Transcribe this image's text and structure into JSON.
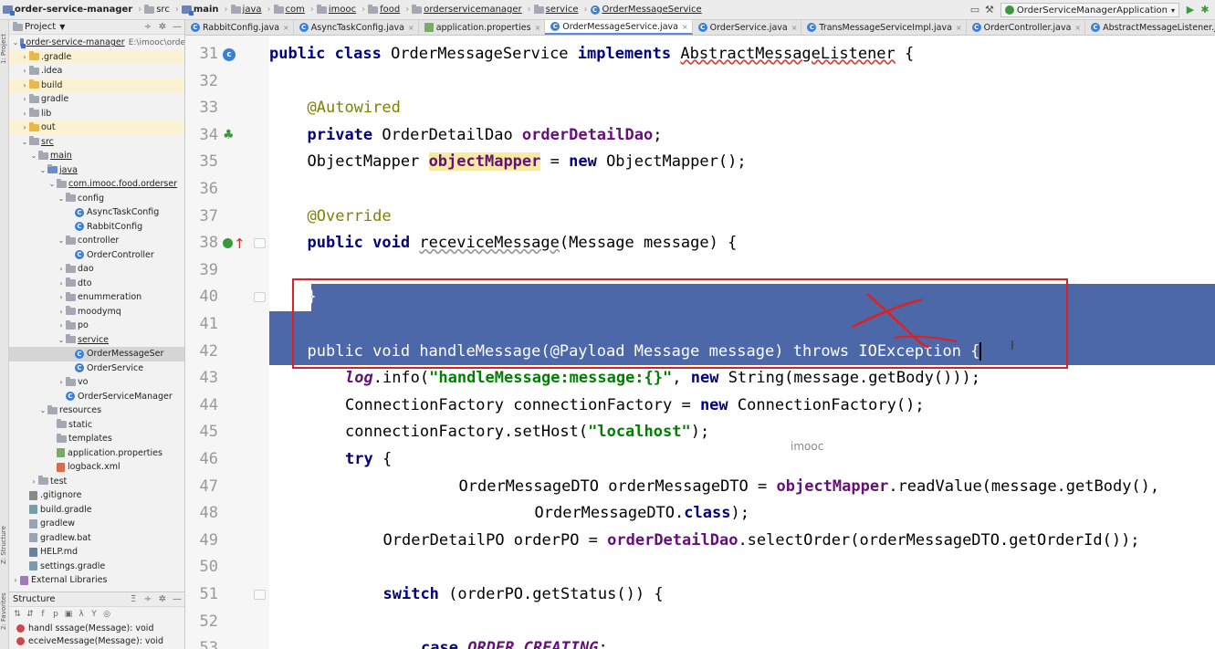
{
  "navbar": {
    "breadcrumbs": [
      {
        "label": "order-service-manager",
        "icon": "module-icon",
        "bold": true
      },
      {
        "label": "src",
        "icon": "folder-icon"
      },
      {
        "label": "main",
        "icon": "module-icon",
        "bold": true
      },
      {
        "label": "java",
        "icon": "folder-icon",
        "underline": true
      },
      {
        "label": "com",
        "icon": "folder-icon",
        "underline": true
      },
      {
        "label": "imooc",
        "icon": "folder-icon",
        "underline": true
      },
      {
        "label": "food",
        "icon": "folder-icon",
        "underline": true
      },
      {
        "label": "orderservicemanager",
        "icon": "folder-icon",
        "underline": true
      },
      {
        "label": "service",
        "icon": "folder-icon",
        "underline": true
      },
      {
        "label": "OrderMessageService",
        "icon": "class-icon",
        "underline": true
      }
    ],
    "run_config": "OrderServiceManagerApplication"
  },
  "sidebar_tabs": [
    "1: Project",
    "Z: Structure",
    "2: Favorites"
  ],
  "project": {
    "title": "Project",
    "tree": [
      {
        "label": "order-service-manager",
        "extra": "E:\\imooc\\orde",
        "level": 0,
        "arrow": "down",
        "icon": "module",
        "ul": true
      },
      {
        "label": ".gradle",
        "level": 1,
        "arrow": "right",
        "icon": "folder-yellow",
        "hl": true
      },
      {
        "label": ".idea",
        "level": 1,
        "arrow": "right",
        "icon": "folder"
      },
      {
        "label": "build",
        "level": 1,
        "arrow": "right",
        "icon": "folder-yellow",
        "hl": true
      },
      {
        "label": "gradle",
        "level": 1,
        "arrow": "right",
        "icon": "folder"
      },
      {
        "label": "lib",
        "level": 1,
        "arrow": "right",
        "icon": "folder"
      },
      {
        "label": "out",
        "level": 1,
        "arrow": "right",
        "icon": "folder-yellow",
        "hl": true
      },
      {
        "label": "src",
        "level": 1,
        "arrow": "down",
        "icon": "folder",
        "ul": true
      },
      {
        "label": "main",
        "level": 2,
        "arrow": "down",
        "icon": "folder",
        "ul": true
      },
      {
        "label": "java",
        "level": 3,
        "arrow": "down",
        "icon": "folder-blue",
        "ul": true
      },
      {
        "label": "com.imooc.food.orderser",
        "level": 4,
        "arrow": "down",
        "icon": "folder",
        "ul": true
      },
      {
        "label": "config",
        "level": 5,
        "arrow": "down",
        "icon": "folder"
      },
      {
        "label": "AsyncTaskConfig",
        "level": 6,
        "arrow": "",
        "icon": "class"
      },
      {
        "label": "RabbitConfig",
        "level": 6,
        "arrow": "",
        "icon": "class"
      },
      {
        "label": "controller",
        "level": 5,
        "arrow": "down",
        "icon": "folder"
      },
      {
        "label": "OrderController",
        "level": 6,
        "arrow": "",
        "icon": "class"
      },
      {
        "label": "dao",
        "level": 5,
        "arrow": "right",
        "icon": "folder"
      },
      {
        "label": "dto",
        "level": 5,
        "arrow": "right",
        "icon": "folder"
      },
      {
        "label": "enummeration",
        "level": 5,
        "arrow": "right",
        "icon": "folder"
      },
      {
        "label": "moodymq",
        "level": 5,
        "arrow": "right",
        "icon": "folder"
      },
      {
        "label": "po",
        "level": 5,
        "arrow": "right",
        "icon": "folder"
      },
      {
        "label": "service",
        "level": 5,
        "arrow": "down",
        "icon": "folder",
        "ul": true
      },
      {
        "label": "OrderMessageSer",
        "level": 6,
        "arrow": "",
        "icon": "class",
        "sel": true
      },
      {
        "label": "OrderService",
        "level": 6,
        "arrow": "",
        "icon": "class"
      },
      {
        "label": "vo",
        "level": 5,
        "arrow": "right",
        "icon": "folder"
      },
      {
        "label": "OrderServiceManager",
        "level": 5,
        "arrow": "",
        "icon": "class"
      },
      {
        "label": "resources",
        "level": 3,
        "arrow": "down",
        "icon": "folder"
      },
      {
        "label": "static",
        "level": 4,
        "arrow": "",
        "icon": "folder"
      },
      {
        "label": "templates",
        "level": 4,
        "arrow": "",
        "icon": "folder"
      },
      {
        "label": "application.properties",
        "level": 4,
        "arrow": "",
        "icon": "props"
      },
      {
        "label": "logback.xml",
        "level": 4,
        "arrow": "",
        "icon": "xml"
      },
      {
        "label": "test",
        "level": 2,
        "arrow": "right",
        "icon": "folder"
      },
      {
        "label": ".gitignore",
        "level": 1,
        "arrow": "",
        "icon": "git"
      },
      {
        "label": "build.gradle",
        "level": 1,
        "arrow": "",
        "icon": "gradle"
      },
      {
        "label": "gradlew",
        "level": 1,
        "arrow": "",
        "icon": "file"
      },
      {
        "label": "gradlew.bat",
        "level": 1,
        "arrow": "",
        "icon": "file"
      },
      {
        "label": "HELP.md",
        "level": 1,
        "arrow": "",
        "icon": "md"
      },
      {
        "label": "settings.gradle",
        "level": 1,
        "arrow": "",
        "icon": "gradle"
      },
      {
        "label": "External Libraries",
        "level": 0,
        "arrow": "right",
        "icon": "libs"
      }
    ]
  },
  "structure": {
    "title": "Structure",
    "rows": [
      "handl sssage(Message): void",
      "eceiveMessage(Message): void"
    ]
  },
  "tabs": [
    {
      "label": "RabbitConfig.java",
      "active": false
    },
    {
      "label": "AsyncTaskConfig.java",
      "active": false
    },
    {
      "label": "application.properties",
      "active": false
    },
    {
      "label": "OrderMessageService.java",
      "active": true
    },
    {
      "label": "OrderService.java",
      "active": false
    },
    {
      "label": "TransMessageServiceImpl.java",
      "active": false
    },
    {
      "label": "OrderController.java",
      "active": false
    },
    {
      "label": "AbstractMessageListener.java",
      "active": false
    }
  ],
  "editor": {
    "line_numbers": [
      "31",
      "32",
      "33",
      "34",
      "35",
      "36",
      "37",
      "38",
      "39",
      "40",
      "41",
      "42",
      "43",
      "44",
      "45",
      "46",
      "47",
      "48",
      "49",
      "50",
      "51",
      "52",
      "53"
    ],
    "gutter_icons": {
      "0": "class-icon",
      "3": "bean-icon",
      "7": "override-icon"
    },
    "fold_lines": [
      7,
      9,
      20
    ],
    "lines": [
      {
        "indent": 0,
        "selected": false,
        "tokens": [
          [
            "kw",
            "public "
          ],
          [
            "kw",
            "class "
          ],
          [
            "",
            "OrderMessageService "
          ],
          [
            "kw",
            "implements "
          ],
          [
            "squig",
            "AbstractMessageListener"
          ],
          [
            "",
            " {"
          ]
        ]
      },
      {
        "indent": 0,
        "selected": false,
        "tokens": []
      },
      {
        "indent": 1,
        "selected": false,
        "tokens": [
          [
            "ann",
            "@Autowired"
          ]
        ]
      },
      {
        "indent": 1,
        "selected": false,
        "tokens": [
          [
            "kw",
            "private "
          ],
          [
            "",
            "OrderDetailDao "
          ],
          [
            "field",
            "orderDetailDao"
          ],
          [
            "",
            ";"
          ]
        ]
      },
      {
        "indent": 1,
        "selected": false,
        "tokens": [
          [
            "",
            "ObjectMapper "
          ],
          [
            "field hlvar",
            "objectMapper"
          ],
          [
            "",
            " = "
          ],
          [
            "kw",
            "new "
          ],
          [
            "",
            "ObjectMapper();"
          ]
        ]
      },
      {
        "indent": 0,
        "selected": false,
        "tokens": []
      },
      {
        "indent": 1,
        "selected": false,
        "tokens": [
          [
            "ann",
            "@Override"
          ]
        ]
      },
      {
        "indent": 1,
        "selected": false,
        "tokens": [
          [
            "kw",
            "public "
          ],
          [
            "kw",
            "void "
          ],
          [
            "squig2",
            "receviceMessage"
          ],
          [
            "",
            "(Message message) {"
          ]
        ]
      },
      {
        "indent": 0,
        "selected": false,
        "tokens": []
      },
      {
        "indent": 1,
        "selected": true,
        "tokens": [
          [
            "wsel",
            "}"
          ]
        ]
      },
      {
        "indent": 0,
        "selected": true,
        "tokens": []
      },
      {
        "indent": 1,
        "selected": true,
        "tokens": [
          [
            "wsel",
            "public void handleMessage(@Payload Message message) throws IOException {"
          ]
        ]
      },
      {
        "indent": 2,
        "selected": false,
        "tokens": [
          [
            "field ital",
            "log"
          ],
          [
            "",
            ".info("
          ],
          [
            "str",
            "\"handleMessage:message:{}\""
          ],
          [
            "",
            ", "
          ],
          [
            "kw",
            "new "
          ],
          [
            "",
            "String(message.getBody()));"
          ]
        ]
      },
      {
        "indent": 2,
        "selected": false,
        "tokens": [
          [
            "",
            "ConnectionFactory connectionFactory = "
          ],
          [
            "kw",
            "new "
          ],
          [
            "",
            "ConnectionFactory();"
          ]
        ]
      },
      {
        "indent": 2,
        "selected": false,
        "tokens": [
          [
            "",
            "connectionFactory.setHost("
          ],
          [
            "str",
            "\"localhost\""
          ],
          [
            "",
            ");"
          ]
        ]
      },
      {
        "indent": 2,
        "selected": false,
        "tokens": [
          [
            "kw",
            "try "
          ],
          [
            "",
            "{"
          ]
        ]
      },
      {
        "indent": 5,
        "selected": false,
        "tokens": [
          [
            "",
            "OrderMessageDTO orderMessageDTO = "
          ],
          [
            "field",
            "objectMapper"
          ],
          [
            "",
            ".readValue(message.getBody(),"
          ]
        ]
      },
      {
        "indent": 7,
        "selected": false,
        "tokens": [
          [
            "",
            "OrderMessageDTO."
          ],
          [
            "kw",
            "class"
          ],
          [
            "",
            ");"
          ]
        ]
      },
      {
        "indent": 3,
        "selected": false,
        "tokens": [
          [
            "",
            "OrderDetailPO orderPO = "
          ],
          [
            "field",
            "orderDetailDao"
          ],
          [
            "",
            ".selectOrder(orderMessageDTO.getOrderId());"
          ]
        ]
      },
      {
        "indent": 0,
        "selected": false,
        "tokens": []
      },
      {
        "indent": 3,
        "selected": false,
        "tokens": [
          [
            "kw",
            "switch "
          ],
          [
            "",
            "(orderPO.getStatus()) {"
          ]
        ]
      },
      {
        "indent": 0,
        "selected": false,
        "tokens": []
      },
      {
        "indent": 4,
        "selected": false,
        "tokens": [
          [
            "kw",
            "case "
          ],
          [
            "field ital",
            "ORDER_CREATING"
          ],
          [
            "",
            ":"
          ]
        ]
      }
    ]
  },
  "overlay": {
    "watermark": "imooc"
  },
  "colors": {
    "selection": "#4d68a8",
    "annotation_box": "#e02020",
    "keyword": "#000080",
    "string": "#008000",
    "field": "#660e7a",
    "annotation": "#808000"
  }
}
